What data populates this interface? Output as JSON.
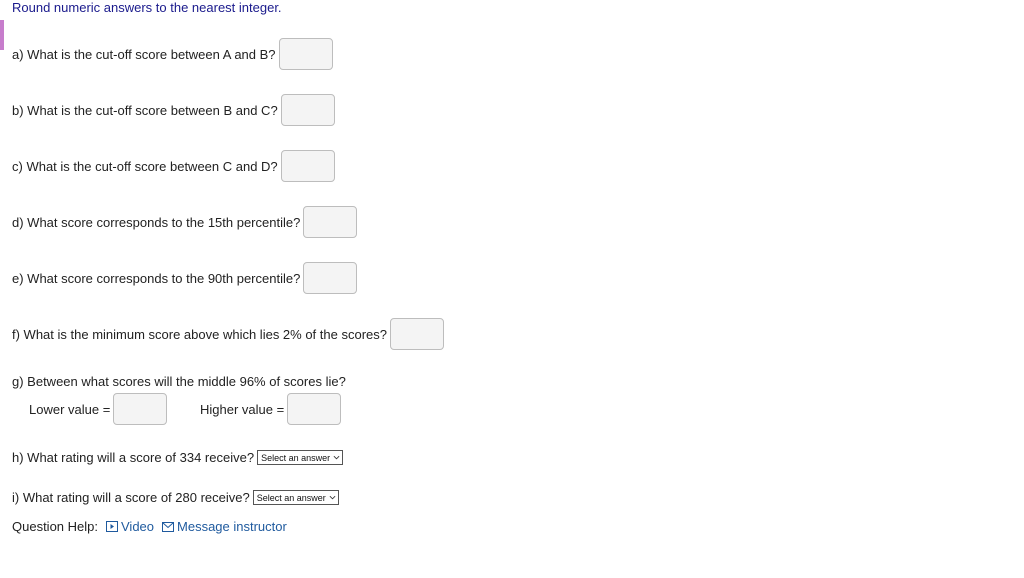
{
  "instruction": "Round numeric answers to the nearest integer.",
  "colors": {
    "instruction_text": "#1a1a8c",
    "accent_bar": "#c77dcc",
    "link": "#1f5a9e"
  },
  "questions": {
    "a": "a) What is the cut-off score between A and B?",
    "b": "b) What is the cut-off score between B and C?",
    "c": "c) What is the cut-off score between C and D?",
    "d": "d) What score corresponds to the 15th percentile?",
    "e": "e) What score corresponds to the 90th percentile?",
    "f": "f) What is the minimum score above which lies 2% of the scores?",
    "g": {
      "label": "g) Between what scores will the middle 96% of scores lie?",
      "lower_label": "Lower value =",
      "higher_label": "Higher value ="
    },
    "h": {
      "label": "h) What rating will a score of 334 receive?",
      "select_value": "Select an answer"
    },
    "i": {
      "label": "i) What rating will a score of 280 receive?",
      "select_value": "Select an answer"
    }
  },
  "help": {
    "label": "Question Help:",
    "video_label": "Video",
    "video_icon": "play-box-icon",
    "message_label": "Message instructor",
    "message_icon": "envelope-icon"
  }
}
